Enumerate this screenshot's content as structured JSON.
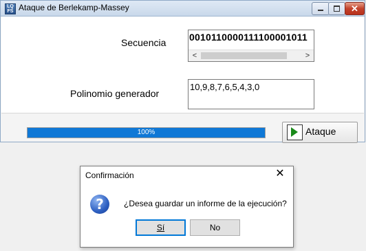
{
  "window": {
    "title": "Ataque de Berlekamp-Massey",
    "icon_text_top": "LQ",
    "icon_text_bottom": "FS",
    "close_glyph": "✕"
  },
  "form": {
    "sequence_label": "Secuencia",
    "sequence_value": "0010110000111100001011",
    "polynomial_label": "Polinomio generador",
    "polynomial_value": "10,9,8,7,6,5,4,3,0",
    "scroll_left": "<",
    "scroll_right": ">"
  },
  "progress": {
    "value": 100,
    "text": "100%",
    "color": "#0f78d6"
  },
  "attack_button": {
    "label": "Ataque",
    "icon": "play-icon",
    "icon_color": "#1a8a1a"
  },
  "dialog": {
    "title": "Confirmación",
    "close_glyph": "✕",
    "icon": "question-icon",
    "icon_glyph": "?",
    "message": "¿Desea guardar un informe de la ejecución?",
    "yes_label": "Sí",
    "no_label": "No"
  }
}
